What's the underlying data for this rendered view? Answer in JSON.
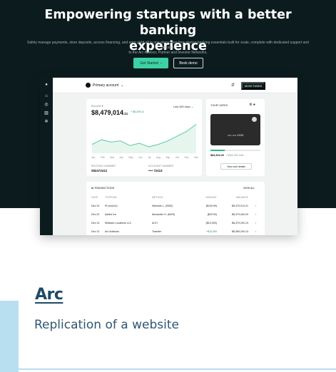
{
  "hero": {
    "title_line1": "Empowering startups with a better banking",
    "title_line2": "experience",
    "subtitle_line1": "Safely manage payments, store deposits, access financing, and earn yield all in one place. Fee-free startup banking essentials built for scale, complete with dedicated support and access",
    "subtitle_line2": "to the Arc Advisor, Partner and Investor Networks.",
    "primary_button": "Get Started",
    "primary_arrow": "›",
    "secondary_button": "Book demo"
  },
  "app": {
    "account_selector": "Primary account",
    "move_funds_button": "MOVE FUNDS",
    "balance": {
      "label": "BALANCE",
      "value": "$8,479,014",
      "cents": ".21",
      "delta": "+ $5,329.41",
      "range": "Last 365 days",
      "months": [
        "Jan",
        "Feb",
        "Mar",
        "Apr",
        "May",
        "Jun",
        "Jul",
        "Aug",
        "Sep",
        "Oct",
        "Nov",
        "Dec"
      ],
      "routing_label": "ROUTING NUMBER",
      "routing_value": "082472413",
      "account_label": "ACCOUNT NUMBER",
      "account_value": "•••• 72413"
    },
    "cards": {
      "title": "YOUR CARDS",
      "card_number": "•••• •••• 4939",
      "spend_fraction": 0.28,
      "spent": "$84,304.20",
      "limit": "/ $300,000 limit",
      "view_button": "View card details"
    },
    "transactions": {
      "title": "TRANSACTIONS",
      "view_all": "VIEW ALL",
      "columns": [
        "DATE",
        "TO/FROM",
        "METHOD",
        "AMOUNT",
        "BALANCE"
      ],
      "rows": [
        {
          "date": "Dec 24",
          "party": "Rippling",
          "status": "PENDING",
          "method": "Nicholas L. (9992)",
          "amount": "($249.99)",
          "balance": "$8,479,014.21"
        },
        {
          "date": "Dec 22",
          "party": "Adobe Inc",
          "status": "",
          "method": "Alexander H. (8429)",
          "amount": "($29.93)",
          "balance": "$8,479,264.20"
        },
        {
          "date": "Dec 14",
          "party": "Midtown Locations LLC",
          "status": "",
          "method": "ACH",
          "amount": "($10,000)",
          "balance": "$8,479,294.13"
        },
        {
          "date": "Dec 12",
          "party": "Arc Advisors",
          "status": "",
          "method": "Transfer",
          "amount": "+$10,000",
          "balance": "$8,389,294.13"
        }
      ]
    },
    "balance_series": [
      4.2,
      4.6,
      4.4,
      4.5,
      4.1,
      4.3,
      4.0,
      4.2,
      4.5,
      4.9,
      5.3,
      5.9
    ]
  },
  "project": {
    "name": "Arc",
    "description": "Replication of a website"
  },
  "colors": {
    "hero_bg": "#0c1c1e",
    "accent_green": "#3ed1a4",
    "chart_line": "#6fd0aa",
    "title_blue": "#1e4a66",
    "accent_blue": "#b8dff0"
  }
}
